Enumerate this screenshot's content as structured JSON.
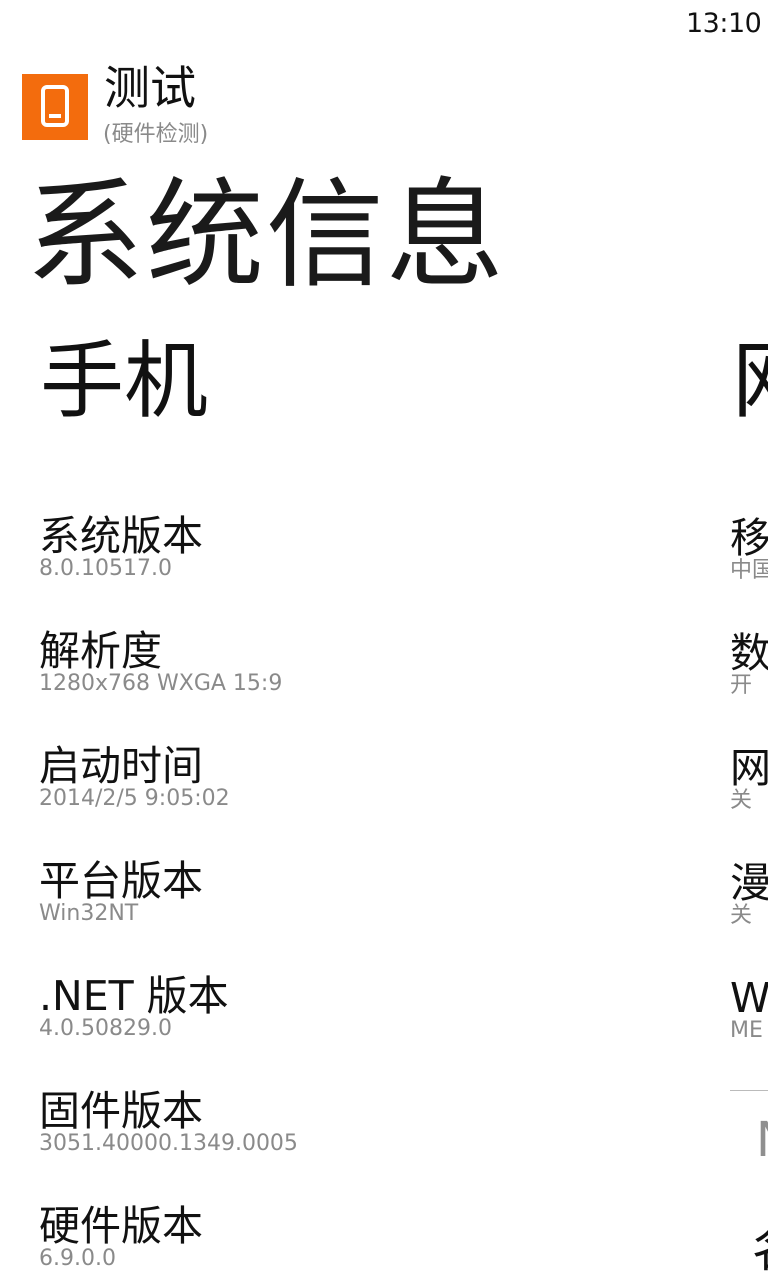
{
  "status_bar": {
    "time": "13:10"
  },
  "app": {
    "title": "测试",
    "subtitle": "(硬件检测)",
    "tile_color": "#f36c0d",
    "tile_icon": "phone-icon"
  },
  "panorama": {
    "title": "系统信息"
  },
  "phone_section": {
    "header": "手机",
    "items": [
      {
        "label": "系统版本",
        "value": "8.0.10517.0"
      },
      {
        "label": "解析度",
        "value": "1280x768  WXGA 15:9"
      },
      {
        "label": "启动时间",
        "value": "2014/2/5 9:05:02"
      },
      {
        "label": "平台版本",
        "value": "Win32NT"
      },
      {
        "label": ".NET 版本",
        "value": "4.0.50829.0"
      },
      {
        "label": "固件版本",
        "value": "3051.40000.1349.0005"
      },
      {
        "label": "硬件版本",
        "value": "6.9.0.0"
      }
    ]
  },
  "network_section": {
    "header": "网",
    "items": [
      {
        "label": "移",
        "value": "中国"
      },
      {
        "label": "数",
        "value": "开"
      },
      {
        "label": "网",
        "value": "关"
      },
      {
        "label": "漫",
        "value": "关"
      },
      {
        "label": "W",
        "value": "ME"
      }
    ],
    "partial_bottom_1": "N",
    "partial_bottom_2": "名"
  }
}
